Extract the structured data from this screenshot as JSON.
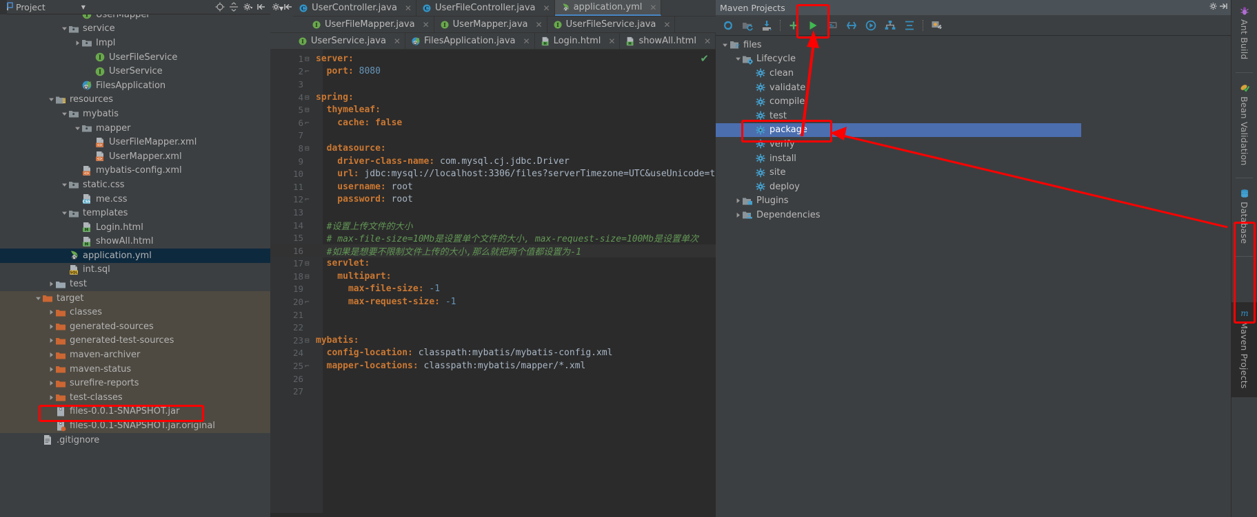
{
  "project_panel": {
    "title": "Project",
    "icons": [
      "project-view-icon",
      "chevron-down-icon",
      "locate-icon",
      "collapse-all-icon",
      "settings-icon",
      "hide-icon"
    ],
    "tree": [
      {
        "label": "UserMapper",
        "indent": 5,
        "arrow": "none",
        "icon": "interface-icon",
        "state": "clipped"
      },
      {
        "label": "service",
        "indent": 4,
        "arrow": "down",
        "icon": "package-folder-icon"
      },
      {
        "label": "Impl",
        "indent": 5,
        "arrow": "right",
        "icon": "package-folder-icon"
      },
      {
        "label": "UserFileService",
        "indent": 6,
        "arrow": "none",
        "icon": "interface-icon"
      },
      {
        "label": "UserService",
        "indent": 6,
        "arrow": "none",
        "icon": "interface-icon"
      },
      {
        "label": "FilesApplication",
        "indent": 5,
        "arrow": "none",
        "icon": "spring-class-icon"
      },
      {
        "label": "resources",
        "indent": 3,
        "arrow": "down",
        "icon": "resources-folder-icon"
      },
      {
        "label": "mybatis",
        "indent": 4,
        "arrow": "down",
        "icon": "package-folder-icon"
      },
      {
        "label": "mapper",
        "indent": 5,
        "arrow": "down",
        "icon": "package-folder-icon"
      },
      {
        "label": "UserFileMapper.xml",
        "indent": 6,
        "arrow": "none",
        "icon": "xml-file-icon"
      },
      {
        "label": "UserMapper.xml",
        "indent": 6,
        "arrow": "none",
        "icon": "xml-file-icon"
      },
      {
        "label": "mybatis-config.xml",
        "indent": 5,
        "arrow": "none",
        "icon": "xml-file-icon"
      },
      {
        "label": "static.css",
        "indent": 4,
        "arrow": "down",
        "icon": "package-folder-icon"
      },
      {
        "label": "me.css",
        "indent": 5,
        "arrow": "none",
        "icon": "css-file-icon"
      },
      {
        "label": "templates",
        "indent": 4,
        "arrow": "down",
        "icon": "package-folder-icon"
      },
      {
        "label": "Login.html",
        "indent": 5,
        "arrow": "none",
        "icon": "html-file-icon"
      },
      {
        "label": "showAll.html",
        "indent": 5,
        "arrow": "none",
        "icon": "html-file-icon"
      },
      {
        "label": "application.yml",
        "indent": 4,
        "arrow": "none",
        "icon": "spring-yaml-icon",
        "selected": true
      },
      {
        "label": "int.sql",
        "indent": 4,
        "arrow": "none",
        "icon": "sql-file-icon"
      },
      {
        "label": "test",
        "indent": 3,
        "arrow": "right",
        "icon": "test-folder-icon"
      },
      {
        "label": "target",
        "indent": 2,
        "arrow": "down",
        "icon": "orange-folder-icon",
        "target": true
      },
      {
        "label": "classes",
        "indent": 3,
        "arrow": "right",
        "icon": "orange-folder-icon",
        "target": true
      },
      {
        "label": "generated-sources",
        "indent": 3,
        "arrow": "right",
        "icon": "orange-folder-icon",
        "target": true
      },
      {
        "label": "generated-test-sources",
        "indent": 3,
        "arrow": "right",
        "icon": "orange-folder-icon",
        "target": true
      },
      {
        "label": "maven-archiver",
        "indent": 3,
        "arrow": "right",
        "icon": "orange-folder-icon",
        "target": true
      },
      {
        "label": "maven-status",
        "indent": 3,
        "arrow": "right",
        "icon": "orange-folder-icon",
        "target": true
      },
      {
        "label": "surefire-reports",
        "indent": 3,
        "arrow": "right",
        "icon": "orange-folder-icon",
        "target": true
      },
      {
        "label": "test-classes",
        "indent": 3,
        "arrow": "right",
        "icon": "orange-folder-icon",
        "target": true
      },
      {
        "label": "files-0.0.1-SNAPSHOT.jar",
        "indent": 3,
        "arrow": "none",
        "icon": "jar-file-icon",
        "target": true
      },
      {
        "label": "files-0.0.1-SNAPSHOT.jar.original",
        "indent": 3,
        "arrow": "none",
        "icon": "jar-original-icon",
        "target": true
      },
      {
        "label": ".gitignore",
        "indent": 2,
        "arrow": "none",
        "icon": "gitignore-file-icon"
      }
    ]
  },
  "editor": {
    "tab_rows": [
      [
        {
          "label": "UserController.java",
          "icon": "java-class-icon",
          "closable": true
        },
        {
          "label": "UserFileController.java",
          "icon": "java-class-icon",
          "closable": true
        },
        {
          "label": "application.yml",
          "icon": "spring-yaml-icon",
          "closable": true,
          "active": true
        }
      ],
      [
        {
          "label": "UserFileMapper.java",
          "icon": "interface-icon",
          "closable": true
        },
        {
          "label": "UserMapper.java",
          "icon": "interface-icon",
          "closable": true
        },
        {
          "label": "UserFileService.java",
          "icon": "interface-icon",
          "closable": true
        }
      ],
      [
        {
          "label": "UserService.java",
          "icon": "interface-icon",
          "closable": true
        },
        {
          "label": "FilesApplication.java",
          "icon": "spring-class-icon",
          "closable": true
        },
        {
          "label": "Login.html",
          "icon": "html-file-icon",
          "closable": true
        },
        {
          "label": "showAll.html",
          "icon": "html-file-icon",
          "closable": true
        }
      ]
    ],
    "inspection_status": "ok-checkmark",
    "code_lines": [
      {
        "n": 1,
        "fold": "open",
        "tokens": [
          {
            "t": "server:",
            "c": "k"
          }
        ]
      },
      {
        "n": 2,
        "fold": "end",
        "tokens": [
          {
            "t": "  port: ",
            "c": "k"
          },
          {
            "t": "8080",
            "c": "num"
          }
        ]
      },
      {
        "n": 3,
        "fold": "",
        "tokens": []
      },
      {
        "n": 4,
        "fold": "open",
        "tokens": [
          {
            "t": "spring:",
            "c": "k"
          }
        ]
      },
      {
        "n": 5,
        "fold": "open",
        "tokens": [
          {
            "t": "  thymeleaf:",
            "c": "k"
          }
        ]
      },
      {
        "n": 6,
        "fold": "end",
        "tokens": [
          {
            "t": "    cache: ",
            "c": "k"
          },
          {
            "t": "false",
            "c": "k"
          }
        ]
      },
      {
        "n": 7,
        "fold": "",
        "tokens": []
      },
      {
        "n": 8,
        "fold": "open",
        "tokens": [
          {
            "t": "  datasource:",
            "c": "k"
          }
        ]
      },
      {
        "n": 9,
        "fold": "",
        "tokens": [
          {
            "t": "    driver-class-name: ",
            "c": "k"
          },
          {
            "t": "com.mysql.cj.jdbc.Driver",
            "c": "str"
          }
        ]
      },
      {
        "n": 10,
        "fold": "",
        "tokens": [
          {
            "t": "    url: ",
            "c": "k"
          },
          {
            "t": "jdbc:mysql://localhost:3306/files?serverTimezone=UTC&useUnicode=t",
            "c": "str"
          }
        ]
      },
      {
        "n": 11,
        "fold": "",
        "tokens": [
          {
            "t": "    username: ",
            "c": "k"
          },
          {
            "t": "root",
            "c": "str"
          }
        ]
      },
      {
        "n": 12,
        "fold": "end",
        "tokens": [
          {
            "t": "    password: ",
            "c": "k"
          },
          {
            "t": "root",
            "c": "str"
          }
        ]
      },
      {
        "n": 13,
        "fold": "",
        "tokens": []
      },
      {
        "n": 14,
        "fold": "",
        "tokens": [
          {
            "t": "  #设置上传文件的大小",
            "c": "cmt"
          }
        ]
      },
      {
        "n": 15,
        "fold": "",
        "tokens": [
          {
            "t": "  # max-file-size=10Mb是设置单个文件的大小, max-request-size=100Mb是设置单次",
            "c": "cmt"
          }
        ]
      },
      {
        "n": 16,
        "fold": "",
        "highlight": true,
        "tokens": [
          {
            "t": "  #如果是想要不限制文件上传的大小,那么就把两个值都设置为-1",
            "c": "cmt"
          }
        ]
      },
      {
        "n": 17,
        "fold": "open",
        "tokens": [
          {
            "t": "  servlet:",
            "c": "k"
          }
        ]
      },
      {
        "n": 18,
        "fold": "open",
        "tokens": [
          {
            "t": "    multipart:",
            "c": "k"
          }
        ]
      },
      {
        "n": 19,
        "fold": "",
        "tokens": [
          {
            "t": "      max-file-size: ",
            "c": "k"
          },
          {
            "t": "-1",
            "c": "num"
          }
        ]
      },
      {
        "n": 20,
        "fold": "end",
        "tokens": [
          {
            "t": "      max-request-size: ",
            "c": "k"
          },
          {
            "t": "-1",
            "c": "num"
          }
        ]
      },
      {
        "n": 21,
        "fold": "",
        "tokens": []
      },
      {
        "n": 22,
        "fold": "",
        "tokens": []
      },
      {
        "n": 23,
        "fold": "open",
        "tokens": [
          {
            "t": "mybatis:",
            "c": "k"
          }
        ]
      },
      {
        "n": 24,
        "fold": "",
        "tokens": [
          {
            "t": "  config-location: ",
            "c": "k"
          },
          {
            "t": "classpath:mybatis/mybatis-config.xml",
            "c": "str"
          }
        ]
      },
      {
        "n": 25,
        "fold": "end",
        "tokens": [
          {
            "t": "  mapper-locations: ",
            "c": "k"
          },
          {
            "t": "classpath:mybatis/mapper/*.xml",
            "c": "str"
          }
        ]
      },
      {
        "n": 26,
        "fold": "",
        "tokens": []
      },
      {
        "n": 27,
        "fold": "",
        "tokens": []
      }
    ]
  },
  "maven_panel": {
    "title": "Maven Projects",
    "header_icons": [
      "settings-icon",
      "hide-icon"
    ],
    "toolbar": [
      {
        "name": "reimport-icon",
        "title": "Reimport All Maven Projects"
      },
      {
        "name": "generate-sources-icon",
        "title": "Generate Sources and Update Folders"
      },
      {
        "name": "download-sources-icon",
        "title": "Download Sources"
      },
      {
        "name": "add-maven-project-icon",
        "title": "Add Maven Projects"
      },
      {
        "name": "run-maven-build-icon",
        "title": "Execute Maven Goal",
        "highlighted": true
      },
      {
        "name": "toggle-offline-icon",
        "title": "Toggle Offline Mode"
      },
      {
        "name": "skip-tests-icon",
        "title": "Skip Tests"
      },
      {
        "name": "collapse-all-icon",
        "title": "Collapse All"
      },
      {
        "name": "show-dependencies-icon",
        "title": "Show Dependencies"
      },
      {
        "name": "expand-icon",
        "title": "Expand"
      },
      {
        "name": "maven-settings-icon",
        "title": "Maven Settings"
      }
    ],
    "tree": [
      {
        "label": "files",
        "indent": 0,
        "arrow": "down",
        "icon": "maven-project-icon"
      },
      {
        "label": "Lifecycle",
        "indent": 1,
        "arrow": "down",
        "icon": "lifecycle-folder-icon"
      },
      {
        "label": "clean",
        "indent": 2,
        "arrow": "none",
        "icon": "maven-goal-icon"
      },
      {
        "label": "validate",
        "indent": 2,
        "arrow": "none",
        "icon": "maven-goal-icon"
      },
      {
        "label": "compile",
        "indent": 2,
        "arrow": "none",
        "icon": "maven-goal-icon"
      },
      {
        "label": "test",
        "indent": 2,
        "arrow": "none",
        "icon": "maven-goal-icon"
      },
      {
        "label": "package",
        "indent": 2,
        "arrow": "none",
        "icon": "maven-goal-icon",
        "selected": true
      },
      {
        "label": "verify",
        "indent": 2,
        "arrow": "none",
        "icon": "maven-goal-icon"
      },
      {
        "label": "install",
        "indent": 2,
        "arrow": "none",
        "icon": "maven-goal-icon"
      },
      {
        "label": "site",
        "indent": 2,
        "arrow": "none",
        "icon": "maven-goal-icon"
      },
      {
        "label": "deploy",
        "indent": 2,
        "arrow": "none",
        "icon": "maven-goal-icon"
      },
      {
        "label": "Plugins",
        "indent": 1,
        "arrow": "right",
        "icon": "plugins-folder-icon"
      },
      {
        "label": "Dependencies",
        "indent": 1,
        "arrow": "right",
        "icon": "dependencies-folder-icon"
      }
    ]
  },
  "right_sidebar": {
    "tabs": [
      {
        "label": "Ant Build",
        "icon": "ant-icon",
        "active": false
      },
      {
        "label": "Bean Validation",
        "icon": "bean-validation-icon",
        "active": false
      },
      {
        "label": "Database",
        "icon": "database-icon",
        "active": false
      },
      {
        "label": "Maven Projects",
        "icon": "maven-m-icon",
        "active": true
      }
    ]
  },
  "annotations": {
    "accent_color": "#ff0000",
    "boxes": [
      {
        "name": "run-maven-goal-highlight"
      },
      {
        "name": "package-goal-highlight"
      },
      {
        "name": "jar-artifact-highlight"
      },
      {
        "name": "maven-projects-tab-highlight"
      }
    ]
  }
}
